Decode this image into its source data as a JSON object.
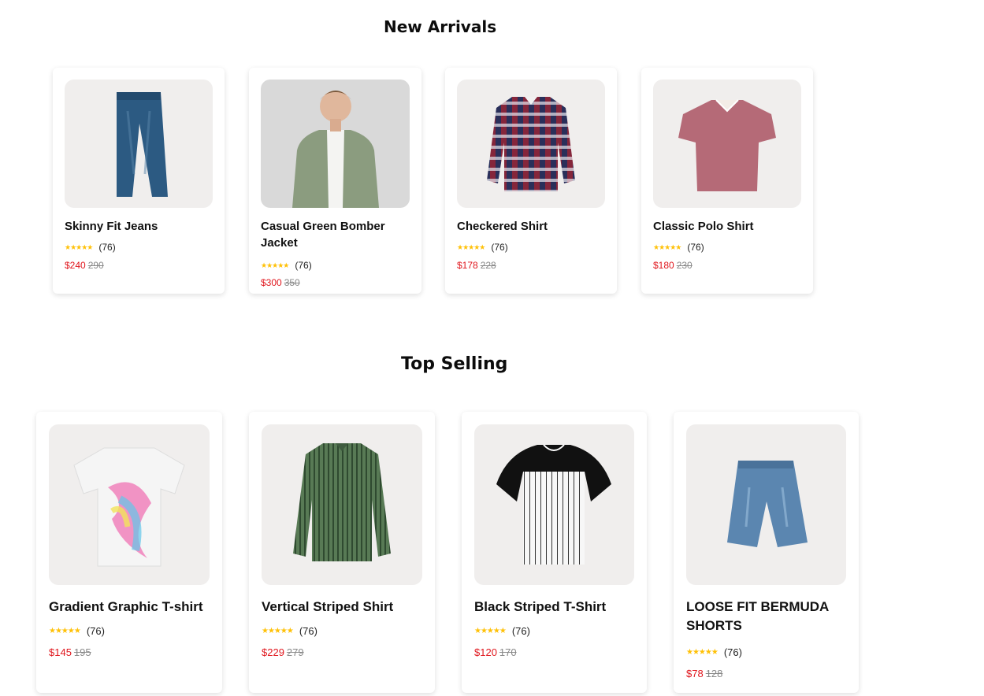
{
  "sections": {
    "new_arrivals": {
      "title": "New Arrivals",
      "products": [
        {
          "name": "Skinny Fit Jeans",
          "reviews": "(76)",
          "price": "$240",
          "old_price": "290",
          "rating": 5,
          "image_icon": "jeans-icon"
        },
        {
          "name": "Casual Green Bomber Jacket",
          "reviews": "(76)",
          "price": "$300",
          "old_price": "350",
          "rating": 5,
          "image_icon": "bomber-jacket-photo"
        },
        {
          "name": "Checkered Shirt",
          "reviews": "(76)",
          "price": "$178",
          "old_price": "228",
          "rating": 5,
          "image_icon": "checkered-shirt-icon"
        },
        {
          "name": "Classic Polo Shirt",
          "reviews": "(76)",
          "price": "$180",
          "old_price": "230",
          "rating": 5,
          "image_icon": "polo-shirt-icon"
        }
      ]
    },
    "top_selling": {
      "title": "Top Selling",
      "products": [
        {
          "name": "Gradient Graphic T-shirt",
          "reviews": "(76)",
          "price": "$145",
          "old_price": "195",
          "rating": 5,
          "image_icon": "graphic-tshirt-icon"
        },
        {
          "name": "Vertical Striped Shirt",
          "reviews": "(76)",
          "price": "$229",
          "old_price": "279",
          "rating": 5,
          "image_icon": "striped-shirt-icon"
        },
        {
          "name": "Black Striped T-Shirt",
          "reviews": "(76)",
          "price": "$120",
          "old_price": "170",
          "rating": 5,
          "image_icon": "raglan-tshirt-icon"
        },
        {
          "name": "LOOSE FIT BERMUDA SHORTS",
          "reviews": "(76)",
          "price": "$78",
          "old_price": "128",
          "rating": 5,
          "image_icon": "denim-shorts-icon"
        }
      ]
    }
  },
  "colors": {
    "price": "#e0151c",
    "star": "#ffc107",
    "thumb_bg": "#f0eeed"
  }
}
